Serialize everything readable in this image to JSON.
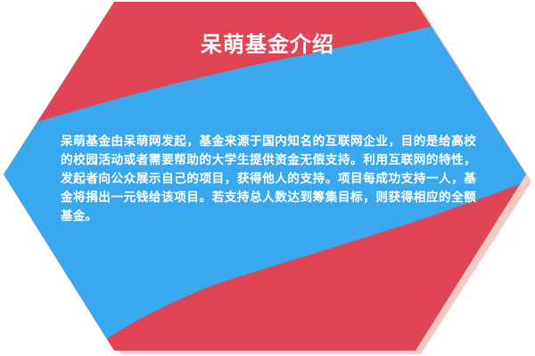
{
  "card": {
    "title": "呆萌基金介绍",
    "description": "呆萌基金由呆萌网发起，基金来源于国内知名的互联网企业，目的是给高校的校园活动或者需要帮助的大学生提供资金无偿支持。利用互联网的特性，发起者向公众展示自己的项目，获得他人的支持。项目每成功支持一人，基金将捐出一元钱给该项目。若支持总人数达到筹集目标，则获得相应的全额基金。"
  },
  "colors": {
    "red": "#df4554",
    "blue": "#3aa8ee",
    "shadow": "#f3c9c2",
    "text": "#ffffff"
  }
}
